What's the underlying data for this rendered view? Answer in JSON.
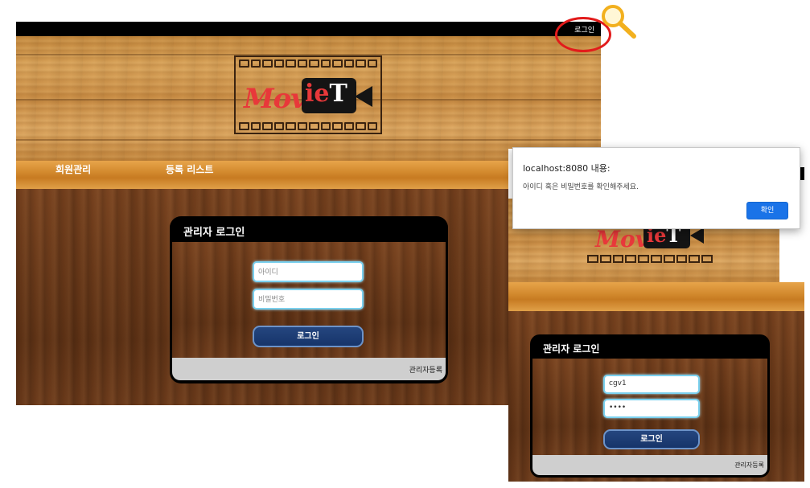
{
  "main": {
    "topbar": {
      "login_link": "로그인"
    },
    "logo": {
      "part_red": "Mov",
      "part_white1": "ie",
      "part_white2": "T"
    },
    "nav": {
      "member_mgmt": "회원관리",
      "register_list": "등록 리스트"
    },
    "login_panel": {
      "title": "관리자 로그인",
      "id_placeholder": "아이디",
      "pw_placeholder": "비밀번호",
      "login_button": "로그인",
      "register_link": "관리자등록"
    }
  },
  "second": {
    "dialog": {
      "title": "localhost:8080 내용:",
      "message": "아이디 혹은 비밀번호를 확인해주세요.",
      "ok_button": "확인",
      "button_color": "#1a73e8"
    },
    "logo": {
      "part_red": "Mov",
      "part_white1": "ie",
      "part_white2": "T"
    },
    "login_panel": {
      "title": "관리자 로그인",
      "id_value": "cgv1",
      "pw_value": "••••",
      "login_button": "로그인",
      "register_link": "관리자등록"
    }
  },
  "annotation": {
    "circle_color": "#e21b1b",
    "magnifier_icon": "magnifier-icon"
  }
}
